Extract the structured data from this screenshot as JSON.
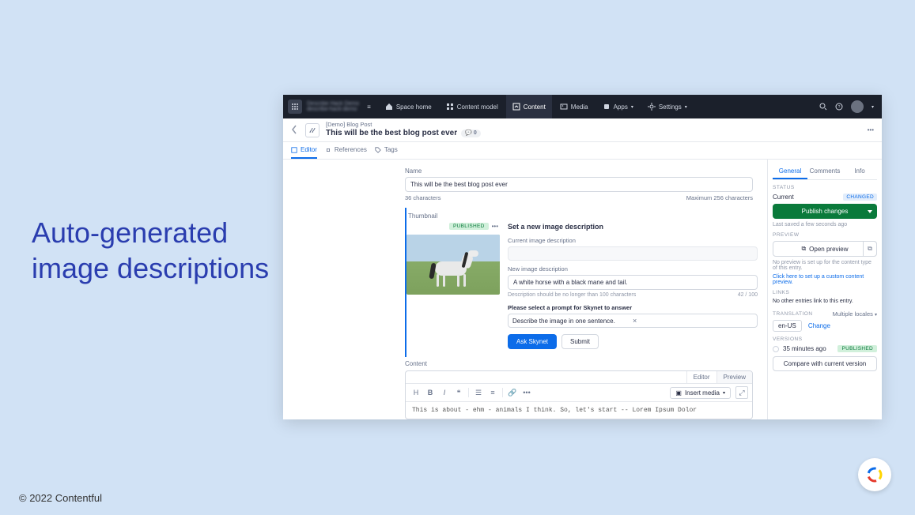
{
  "slide": {
    "title_line1": "Auto-generated",
    "title_line2": "image descriptions",
    "footer": "© 2022 Contentful"
  },
  "topbar": {
    "space_name": "Describe Hack Demo",
    "space_env": "describe-hack-demo",
    "nav": {
      "space_home": "Space home",
      "content_model": "Content model",
      "content": "Content",
      "media": "Media",
      "apps": "Apps",
      "settings": "Settings"
    }
  },
  "header": {
    "content_type": "[Demo] Blog Post",
    "title": "This will be the best blog post ever",
    "comments_count": "0"
  },
  "tabs": {
    "editor": "Editor",
    "references": "References",
    "tags": "Tags"
  },
  "fields": {
    "name": {
      "label": "Name",
      "value": "This will be the best blog post ever",
      "char_count": "36 characters",
      "max": "Maximum 256 characters"
    },
    "thumbnail": {
      "label": "Thumbnail",
      "published_badge": "PUBLISHED",
      "set_heading": "Set a new image description",
      "current_label": "Current image description",
      "new_label": "New image description",
      "new_value": "A white horse with a black mane and tail.",
      "hint": "Description should be no longer than 100 characters",
      "count": "42 / 100",
      "prompt_label": "Please select a prompt for Skynet to answer",
      "prompt_value": "Describe the image in one sentence.",
      "ask": "Ask Skynet",
      "submit": "Submit"
    },
    "content": {
      "label": "Content",
      "editor_tab": "Editor",
      "preview_tab": "Preview",
      "insert_media": "Insert media",
      "body": "This is about - ehm - animals I think. So, let's start -- Lorem Ipsum Dolor"
    }
  },
  "sidebar": {
    "tabs": {
      "general": "General",
      "comments": "Comments",
      "info": "Info"
    },
    "status": {
      "heading": "STATUS",
      "current_label": "Current",
      "changed": "CHANGED",
      "publish": "Publish changes",
      "last_saved": "Last saved a few seconds ago"
    },
    "preview": {
      "heading": "PREVIEW",
      "open": "Open preview",
      "no_preview": "No preview is set up for the content type of this entry.",
      "setup_link": "Click here to set up a custom content preview."
    },
    "links": {
      "heading": "LINKS",
      "none": "No other entries link to this entry."
    },
    "translation": {
      "heading": "TRANSLATION",
      "multi": "Multiple locales",
      "locale": "en-US",
      "change": "Change"
    },
    "versions": {
      "heading": "VERSIONS",
      "time": "35 minutes ago",
      "published": "PUBLISHED",
      "compare": "Compare with current version"
    }
  }
}
